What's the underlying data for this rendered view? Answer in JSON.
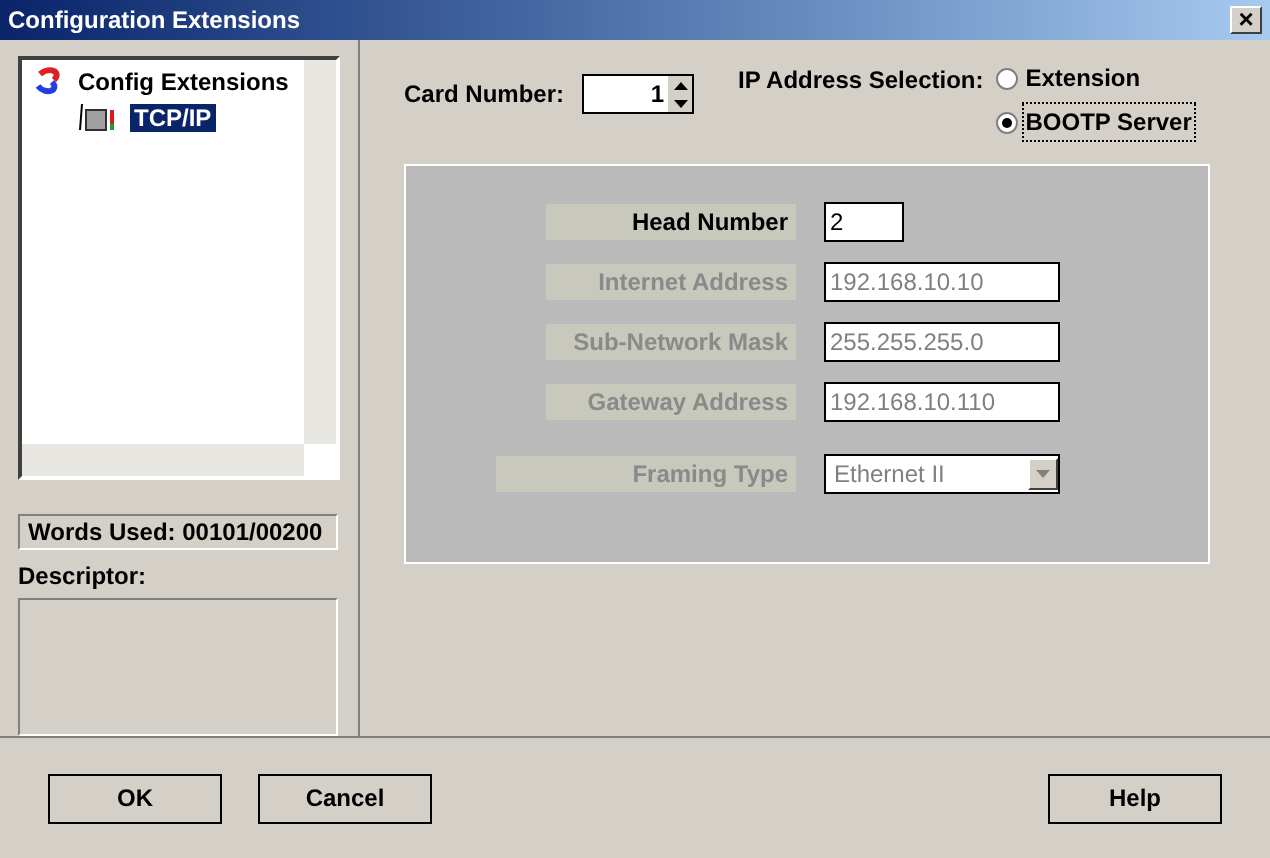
{
  "window": {
    "title": "Configuration Extensions",
    "close": "×"
  },
  "tree": {
    "items": [
      {
        "label": "Config Extensions",
        "selected": false,
        "children": [
          {
            "label": "TCP/IP",
            "selected": true
          }
        ]
      }
    ]
  },
  "words_used": "Words Used: 00101/00200",
  "descriptor": {
    "label": "Descriptor:"
  },
  "card_number": {
    "label": "Card Number:",
    "value": "1"
  },
  "ip_selection": {
    "label": "IP Address Selection:",
    "options": [
      {
        "label": "Extension",
        "selected": false
      },
      {
        "label": "BOOTP Server",
        "selected": true
      }
    ]
  },
  "fields": [
    {
      "label": "Head Number",
      "value": "2",
      "kind": "text",
      "disabled": false
    },
    {
      "label": "Internet Address",
      "value": "192.168.10.10",
      "kind": "text",
      "disabled": true
    },
    {
      "label": "Sub-Network Mask",
      "value": "255.255.255.0",
      "kind": "text",
      "disabled": true
    },
    {
      "label": "Gateway Address",
      "value": "192.168.10.110",
      "kind": "text",
      "disabled": true
    },
    {
      "label": "Framing Type",
      "value": "Ethernet II",
      "kind": "dropdown",
      "disabled": true
    }
  ],
  "buttons": [
    "OK",
    "Cancel",
    "Help"
  ]
}
